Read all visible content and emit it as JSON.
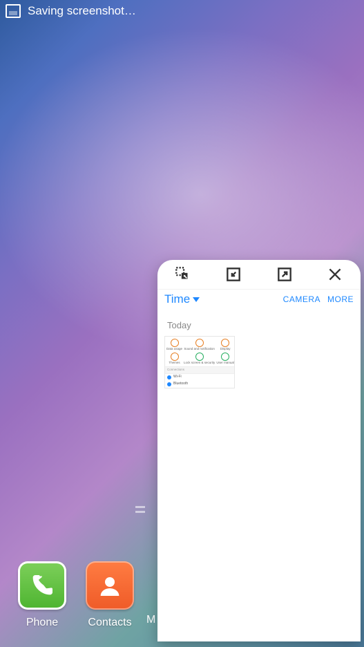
{
  "status": {
    "text": "Saving screenshot…"
  },
  "dock": {
    "phone": "Phone",
    "contacts": "Contacts",
    "cut_letter": "M"
  },
  "popup": {
    "app": {
      "title": "Time",
      "camera": "CAMERA",
      "more": "MORE",
      "section_today": "Today"
    },
    "thumb": {
      "icons": [
        {
          "label": "Data usage",
          "color": "#e67e22"
        },
        {
          "label": "Sound and notification",
          "color": "#e67e22"
        },
        {
          "label": "Display",
          "color": "#e67e22"
        },
        {
          "label": "Themes",
          "color": "#e67e22"
        },
        {
          "label": "Lock screen & security",
          "color": "#27ae60"
        },
        {
          "label": "User manual",
          "color": "#27ae60"
        }
      ],
      "section": "Connections",
      "rows": [
        "Wi-Fi",
        "Bluetooth"
      ]
    }
  }
}
